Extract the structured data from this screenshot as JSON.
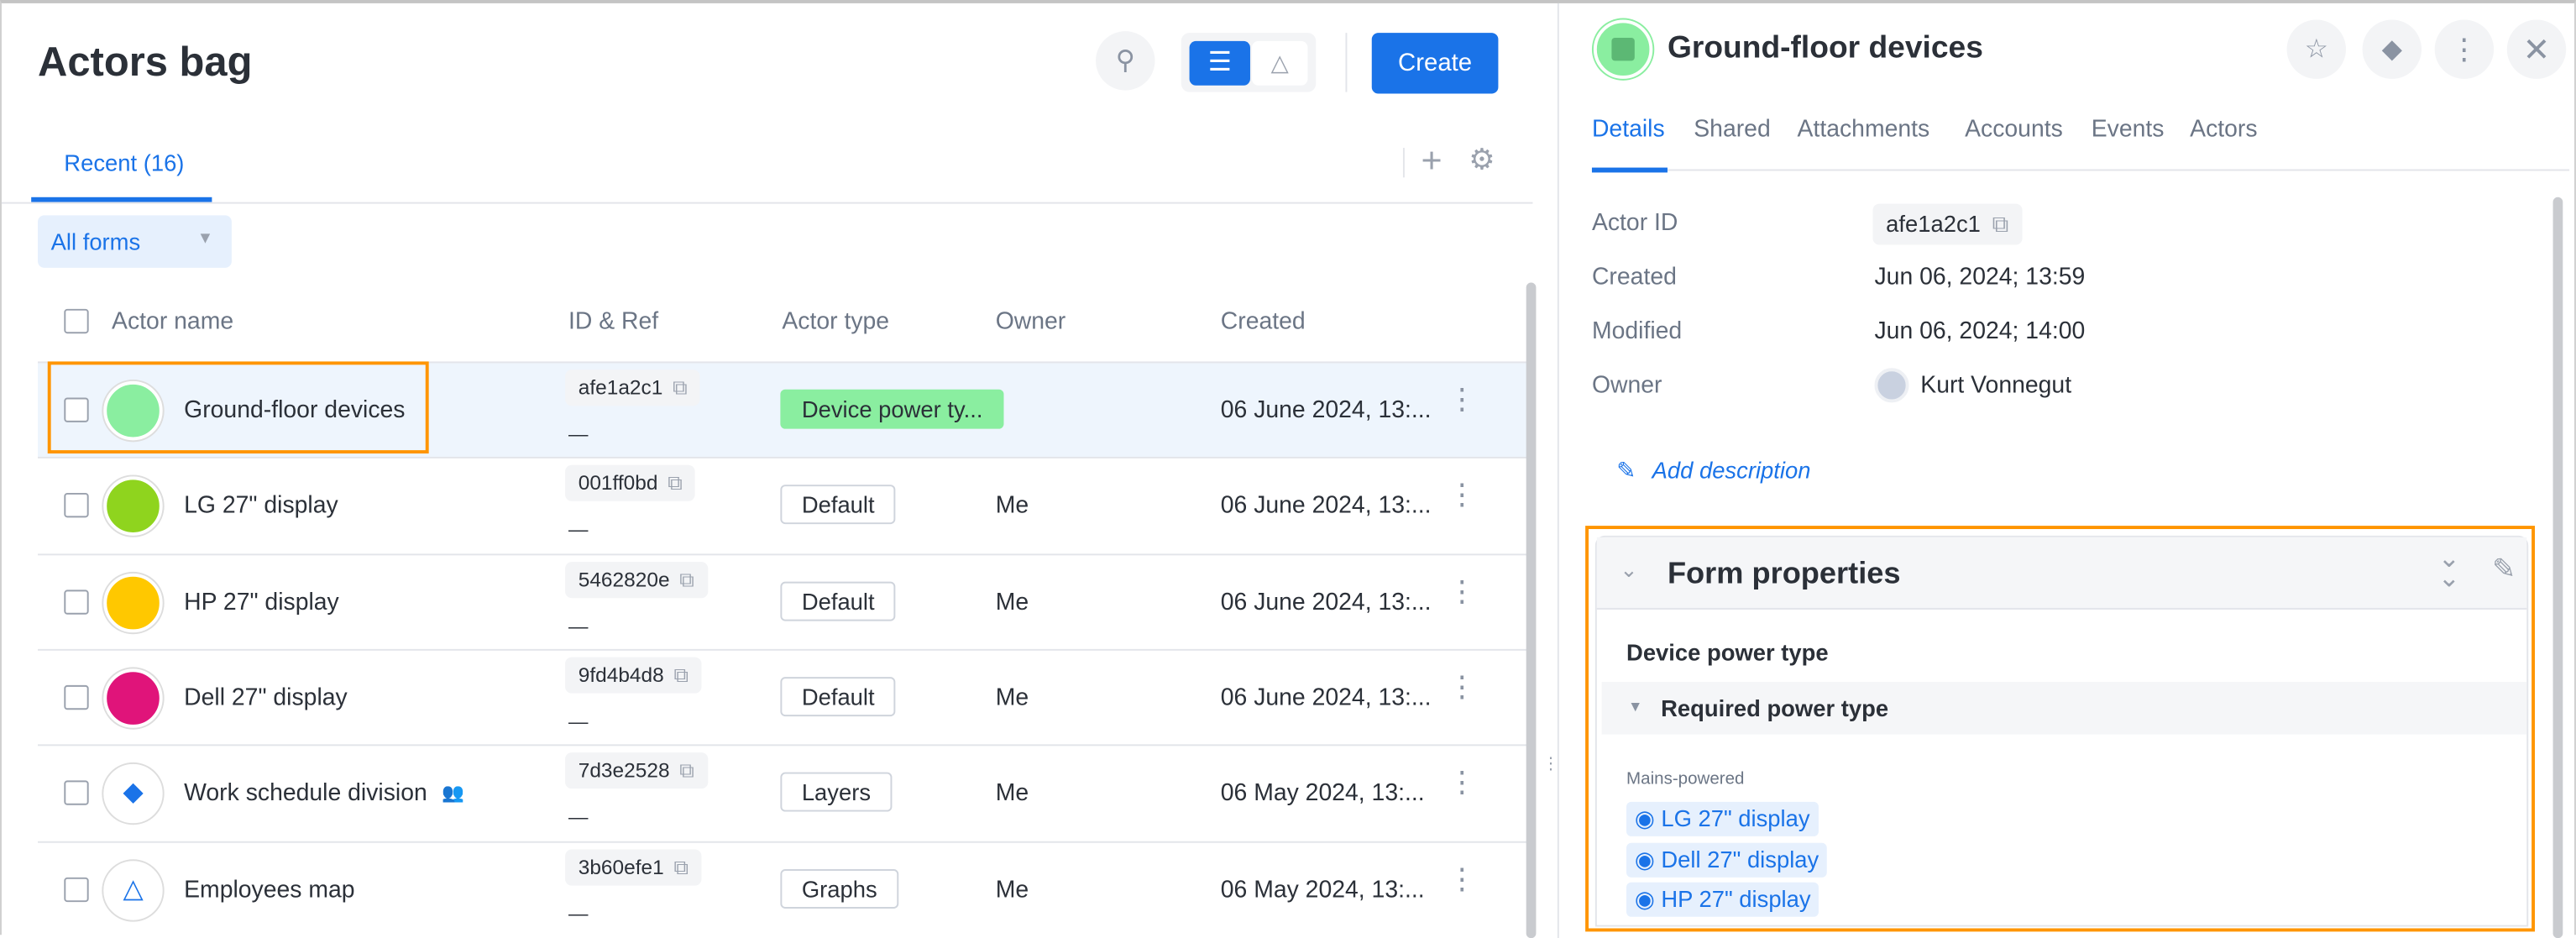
{
  "header": {
    "title": "Actors bag",
    "create_label": "Create",
    "icons": [
      "search-icon",
      "list-view-icon",
      "graph-view-icon"
    ]
  },
  "tabs": [
    {
      "label": "Recent (16)",
      "active": true
    }
  ],
  "filter": {
    "value": "All forms"
  },
  "table": {
    "columns": [
      "Actor name",
      "ID & Ref",
      "Actor type",
      "Owner",
      "Created"
    ],
    "rows": [
      {
        "name": "Ground-floor devices",
        "id": "afe1a2c1",
        "ref": "—",
        "type": "Device power ty...",
        "owner": "",
        "created": "06 June 2024, 13:...",
        "color": "#8aeea0",
        "selected": true
      },
      {
        "name": "LG 27\" display",
        "id": "001ff0bd",
        "ref": "—",
        "type": "Default",
        "owner": "Me",
        "created": "06 June 2024, 13:...",
        "color": "#8fd41e"
      },
      {
        "name": "HP 27\" display",
        "id": "5462820e",
        "ref": "—",
        "type": "Default",
        "owner": "Me",
        "created": "06 June 2024, 13:...",
        "color": "#ffc800"
      },
      {
        "name": "Dell 27\" display",
        "id": "9fd4b4d8",
        "ref": "—",
        "type": "Default",
        "owner": "Me",
        "created": "06 June 2024, 13:...",
        "color": "#e0147a"
      },
      {
        "name": "Work schedule division",
        "id": "7d3e2528",
        "ref": "—",
        "type": "Layers",
        "owner": "Me",
        "created": "06 May 2024, 13:...",
        "icon": "layers-icon",
        "shared": true
      },
      {
        "name": "Employees map",
        "id": "3b60efe1",
        "ref": "—",
        "type": "Graphs",
        "owner": "Me",
        "created": "06 May 2024, 13:...",
        "icon": "graph-icon"
      }
    ]
  },
  "detail": {
    "title": "Ground-floor devices",
    "tabs": [
      "Details",
      "Shared",
      "Attachments",
      "Accounts",
      "Events",
      "Actors"
    ],
    "active_tab": "Details",
    "fields": [
      {
        "label": "Actor ID",
        "value": "afe1a2c1"
      },
      {
        "label": "Created",
        "value": "Jun 06, 2024; 13:59"
      },
      {
        "label": "Modified",
        "value": "Jun 06, 2024; 14:00"
      },
      {
        "label": "Owner",
        "value": "Kurt Vonnegut"
      }
    ],
    "add_description": "Add description",
    "form": {
      "title": "Form properties",
      "section": "Device power type",
      "subsection": "Required power type",
      "field_label": "Mains-powered",
      "values": [
        "LG 27\" display",
        "Dell 27\" display",
        "HP 27\" display"
      ]
    }
  },
  "colors": {
    "accent": "#1a73e8",
    "highlight": "#ff9500",
    "row_selected": "#eef5fd"
  }
}
